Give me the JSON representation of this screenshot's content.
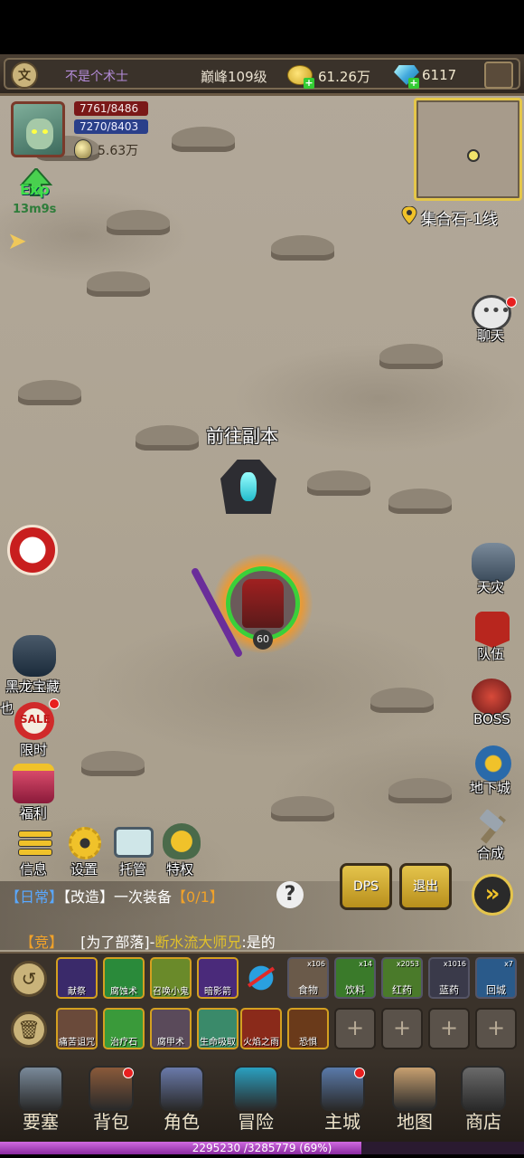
{
  "topbar": {
    "player_name": "不是个术士",
    "level": "巅峰109级",
    "gold": "61.26万",
    "gems": "6117",
    "emblem_glyph": "文"
  },
  "player": {
    "hp": "7761/8486",
    "mp": "7270/8403",
    "power": "5.63万",
    "exp_label": "Exp",
    "exp_timer": "13m9s"
  },
  "location": "集合石-1线",
  "portal_label": "前往副本",
  "hero_level": "60",
  "right_buttons": {
    "chat": "聊天",
    "tianzai": "天灾",
    "team": "队伍",
    "boss": "BOSS",
    "dungeon": "地下城",
    "craft": "合成"
  },
  "left_buttons": {
    "black_dragon": "黑龙宝藏",
    "limited": "限时",
    "welfare": "福利",
    "info": "信息",
    "settings": "设置",
    "auto": "托管",
    "privilege": "特权",
    "partial_char": "也"
  },
  "chat": {
    "line1_tag": "【日常】",
    "line1_text": "【改造】一次装备",
    "line1_progress": "【0/1】",
    "line2_tag": "【竞】",
    "line2_text": "[为了部落]-",
    "line2_name": "断水流大师兄",
    "line2_msg": ":是的"
  },
  "action_buttons": {
    "dps": "DPS",
    "exit": "退出",
    "fast": "»"
  },
  "skills_row1": [
    {
      "label": "献祭",
      "color": "#3a2a6a"
    },
    {
      "label": "腐蚀术",
      "color": "#2a8a3a"
    },
    {
      "label": "召唤小鬼",
      "color": "#6a8a2a"
    },
    {
      "label": "暗影箭",
      "color": "#4a2a7a"
    }
  ],
  "items_row1": [
    {
      "label": "食物",
      "count": "x106",
      "color": "#6a5a4a"
    },
    {
      "label": "饮料",
      "count": "x14",
      "color": "#3a7a2a"
    },
    {
      "label": "红药",
      "count": "x2053",
      "color": "#4a7a2a"
    },
    {
      "label": "蓝药",
      "count": "x1016",
      "color": "#3a3a4a"
    },
    {
      "label": "回城",
      "count": "x7",
      "color": "#2a5a8a"
    }
  ],
  "skills_row2": [
    {
      "label": "痛苦诅咒",
      "color": "#6a4a3a"
    },
    {
      "label": "治疗石",
      "color": "#3a9a3a"
    },
    {
      "label": "腐甲术",
      "color": "#5a4a5a"
    },
    {
      "label": "生命吸取",
      "color": "#3a8a6a"
    },
    {
      "label": "火焰之雨",
      "color": "#8a2a1a"
    },
    {
      "label": "恐惧",
      "color": "#6a3a1a"
    }
  ],
  "empty_slot_glyph": "+",
  "nav": [
    {
      "label": "要塞"
    },
    {
      "label": "背包"
    },
    {
      "label": "角色"
    },
    {
      "label": "冒险"
    },
    {
      "label": "主城"
    },
    {
      "label": "地图"
    },
    {
      "label": "商店"
    }
  ],
  "xp": {
    "text": "2295230 /3285779 (69%)",
    "fraction": 0.69
  },
  "colors": {
    "accent_gold": "#e4c64a",
    "hp_red": "#7a1818",
    "mp_blue": "#2a3f8a",
    "xp_purple": "#b24ec8"
  }
}
